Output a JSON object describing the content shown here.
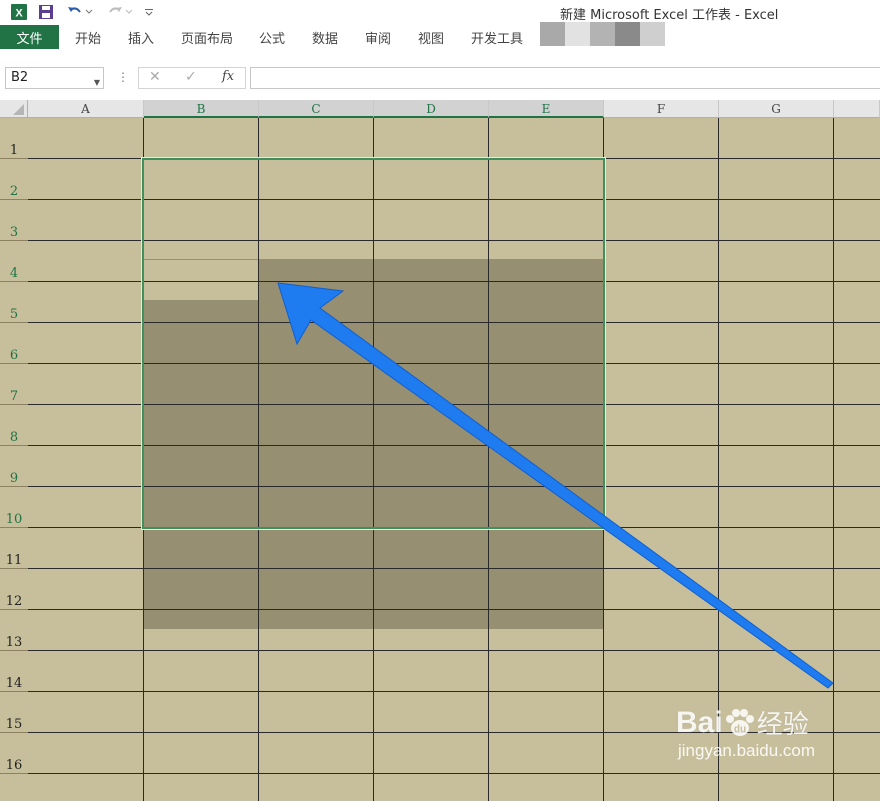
{
  "window": {
    "title": "新建 Microsoft Excel 工作表 - Excel"
  },
  "ribbon": {
    "file_label": "文件",
    "tabs": [
      {
        "label": "开始"
      },
      {
        "label": "插入"
      },
      {
        "label": "页面布局"
      },
      {
        "label": "公式"
      },
      {
        "label": "数据"
      },
      {
        "label": "审阅"
      },
      {
        "label": "视图"
      },
      {
        "label": "开发工具"
      }
    ]
  },
  "formula_bar": {
    "name_box": "B2",
    "cancel_icon": "✕",
    "enter_icon": "✓",
    "fx_label": "fx",
    "formula": ""
  },
  "grid": {
    "columns": [
      "A",
      "B",
      "C",
      "D",
      "E",
      "F",
      "G"
    ],
    "rows": [
      "1",
      "2",
      "3",
      "4",
      "5",
      "6",
      "7",
      "8",
      "9",
      "10",
      "11",
      "12",
      "13",
      "14",
      "15",
      "16"
    ],
    "selected_range": "B2:E10",
    "active_cell": "B2",
    "cell_fill": "#c7bf9b",
    "selection_fill": "#978f72",
    "gridline_color": "#2a2a2a"
  },
  "annotation": {
    "arrow_color": "#1e7cf0"
  },
  "watermark": {
    "brand": "Bai",
    "brand_suffix": "经验",
    "url": "jingyan.baidu.com"
  },
  "theme": {
    "excel_green": "#217346"
  }
}
